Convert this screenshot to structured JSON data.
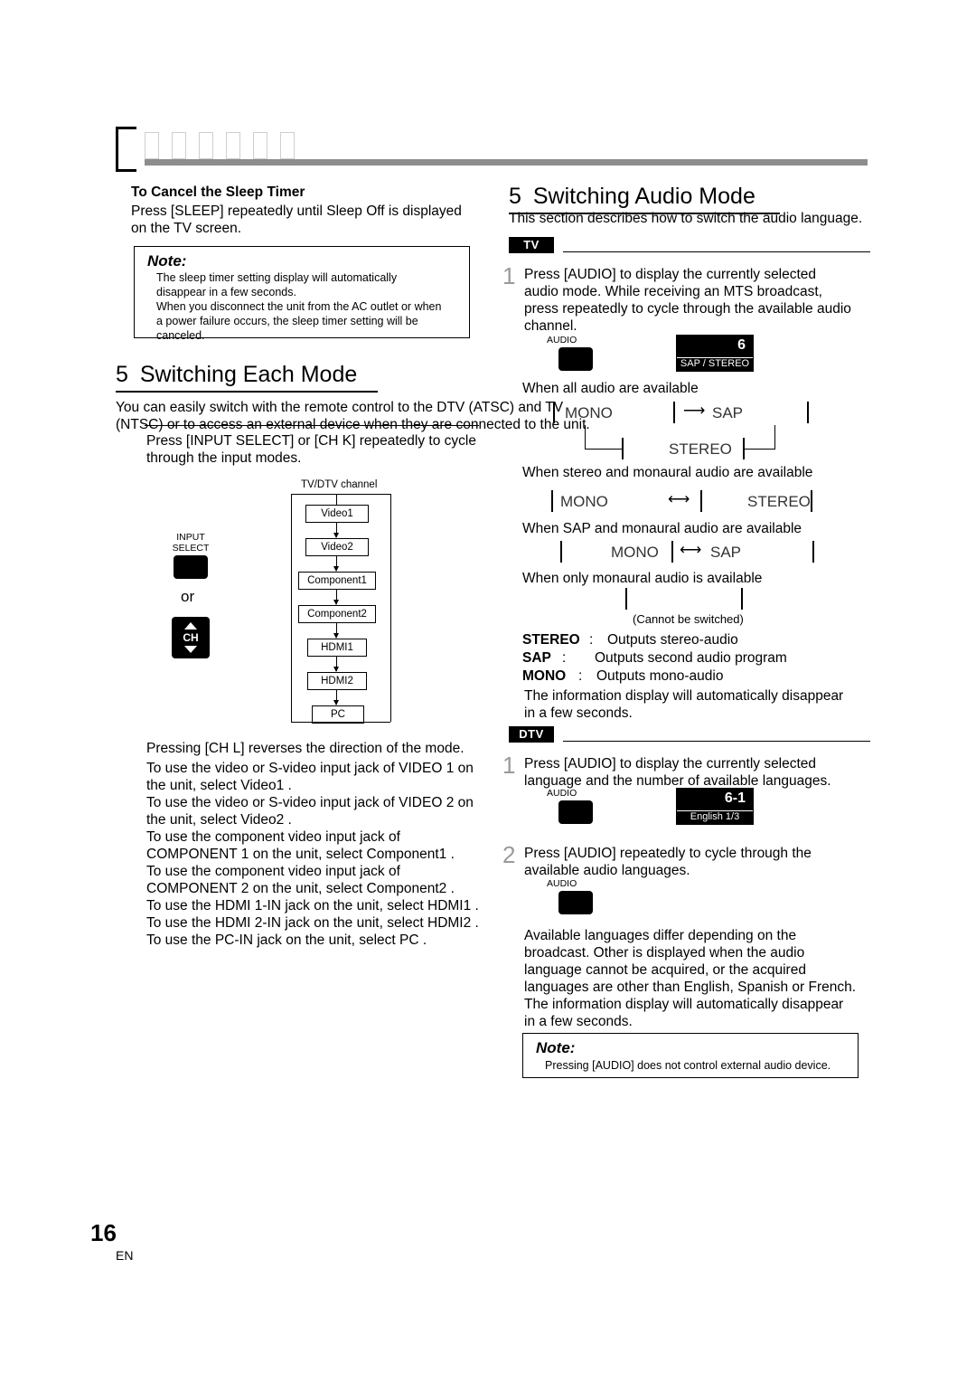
{
  "page": {
    "number": "16",
    "lang": "EN"
  },
  "left": {
    "cancel_sleep": {
      "title": "To Cancel the Sleep Timer",
      "body_1": "Press [SLEEP] repeatedly until  Sleep Off  is displayed",
      "body_2": "on the TV screen."
    },
    "note": {
      "title": "Note:",
      "lines": [
        "The sleep timer setting display will automatically",
        "disappear in a few seconds.",
        "When you disconnect the unit from the AC outlet or when",
        "a power failure occurs, the sleep timer setting will be",
        "canceled."
      ]
    },
    "section": {
      "number": "5",
      "title": "Switching Each Mode"
    },
    "intro_1": "You can easily switch with the remote control to the DTV (ATSC) and TV",
    "intro_2": "(NTSC) or to access an external device when they are connected to the unit.",
    "press_1": "Press [INPUT SELECT] or [CH K] repeatedly to cycle",
    "press_2": "through the input modes.",
    "chart": {
      "caption": "TV/DTV channel",
      "items": [
        "Video1",
        "Video2",
        "Component1",
        "Component2",
        "HDMI1",
        "HDMI2",
        "PC"
      ]
    },
    "remote": {
      "input_select_label_1": "INPUT",
      "input_select_label_2": "SELECT",
      "or": "or",
      "ch_label": "CH"
    },
    "body": [
      "Pressing [CH L] reverses the direction of the mode.",
      "To use the video or S-video input jack of VIDEO 1 on",
      "the unit, select  Video1 .",
      "To use the video or S-video input jack of VIDEO 2 on",
      "the unit, select  Video2 .",
      "To use the component video input jack of",
      "COMPONENT 1 on the unit, select  Component1 .",
      "To use the component video input jack of",
      "COMPONENT 2 on the unit, select  Component2 .",
      "To use the HDMI 1-IN jack on the unit, select  HDMI1 .",
      "To use the HDMI 2-IN jack on the unit, select  HDMI2 .",
      "To use the PC-IN jack on the unit, select  PC ."
    ]
  },
  "right": {
    "section": {
      "number": "5",
      "title": "Switching Audio Mode"
    },
    "intro": "This section describes how to switch the audio language.",
    "tv_tag": "TV",
    "dtv_tag": "DTV",
    "tv_step1": {
      "num": "1",
      "lines": [
        "Press [AUDIO] to display the currently selected",
        "audio mode. While receiving an MTS broadcast,",
        "press repeatedly to cycle through the available audio",
        "channel."
      ]
    },
    "audio_key_label": "AUDIO",
    "osd_tv": {
      "big": "6",
      "sub": "SAP / STEREO"
    },
    "case_all": "When all audio are available",
    "cycle_all": [
      "MONO",
      "SAP",
      "STEREO"
    ],
    "case_stereo_mono": "When stereo and monaural audio are available",
    "cycle_stereo_mono": [
      "MONO",
      "STEREO"
    ],
    "case_sap_mono": "When SAP and monaural audio are available",
    "cycle_sap_mono": [
      "MONO",
      "SAP"
    ],
    "case_mono_only": "When only monaural audio is available",
    "cannot_switch": "(Cannot be switched)",
    "defs": [
      {
        "term": "STEREO",
        "colon": ":",
        "desc": "Outputs stereo-audio"
      },
      {
        "term": "SAP",
        "colon": ":",
        "desc": "Outputs second audio program"
      },
      {
        "term": "MONO",
        "colon": ":",
        "desc": "Outputs mono-audio"
      }
    ],
    "info_tv_1": "The information display will automatically disappear",
    "info_tv_2": "in a few seconds.",
    "dtv_step1": {
      "num": "1",
      "lines": [
        "Press [AUDIO] to display the currently selected",
        "language and the number of available languages."
      ]
    },
    "osd_dtv": {
      "big": "6-1",
      "sub": "English 1/3"
    },
    "dtv_step2": {
      "num": "2",
      "lines": [
        "Press [AUDIO] repeatedly to cycle through the",
        "available audio languages."
      ]
    },
    "dtv_body": [
      "Available languages differ depending on the",
      "broadcast.  Other  is displayed when the audio",
      "language cannot be acquired, or the acquired",
      "languages are other than English, Spanish or French.",
      "The information display will automatically disappear",
      "in a few seconds."
    ],
    "note": {
      "title": "Note:",
      "line": "Pressing [AUDIO] does not control external audio device."
    }
  }
}
